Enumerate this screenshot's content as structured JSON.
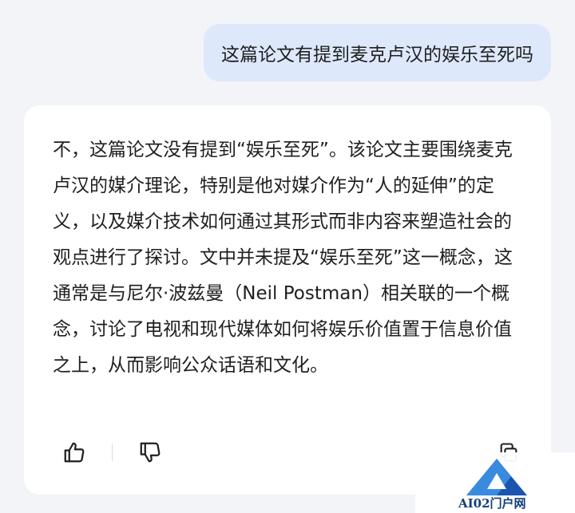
{
  "user_message": {
    "text": "这篇论文有提到麦克卢汉的娱乐至死吗"
  },
  "assistant_reply": {
    "text": "不，这篇论文没有提到“娱乐至死”。该论文主要围绕麦克卢汉的媒介理论，特别是他对媒介作为“人的延伸”的定义，以及媒介技术如何通过其形式而非内容来塑造社会的观点进行了探讨。文中并未提及“娱乐至死”这一概念，这通常是与尼尔·波兹曼（Neil Postman）相关联的一个概念，讨论了电视和现代媒体如何将娱乐价值置于信息价值之上，从而影响公众话语和文化。"
  },
  "actions": {
    "like_icon": "thumbs-up-icon",
    "dislike_icon": "thumbs-down-icon",
    "copy_icon": "copy-icon"
  },
  "watermark": {
    "text": "AI02门户网"
  },
  "colors": {
    "background": "#f3f4f8",
    "user_bubble": "#dde8fb",
    "card": "#ffffff",
    "text": "#1f1f1f",
    "watermark_text": "#123d7a"
  }
}
